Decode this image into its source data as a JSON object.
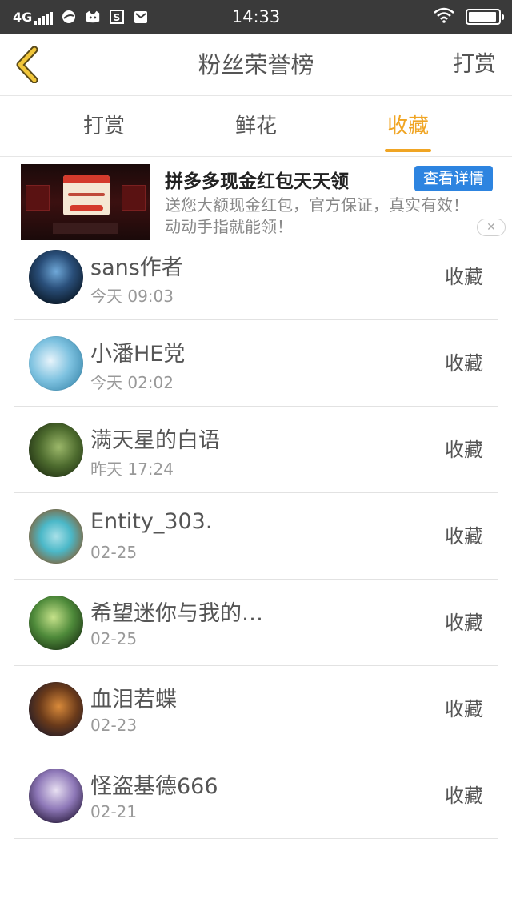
{
  "status_bar": {
    "network": "4G",
    "time": "14:33",
    "icons": [
      "signal-icon",
      "weather-icon",
      "cat-icon",
      "s-icon",
      "mail-icon",
      "wifi-icon",
      "battery-icon"
    ],
    "battery_level": 0.95
  },
  "nav": {
    "title": "粉丝荣誉榜",
    "right_action": "打赏",
    "back_icon": "back-chevron-icon"
  },
  "tabs": [
    {
      "label": "打赏",
      "active": false
    },
    {
      "label": "鲜花",
      "active": false
    },
    {
      "label": "收藏",
      "active": true
    }
  ],
  "colors": {
    "accent": "#f0a524",
    "ad_button": "#2d84e0",
    "status_bar": "#3a3a3a"
  },
  "ad": {
    "title": "拼多多现金红包天天领",
    "cta": "查看详情",
    "desc": "送您大额现金红包，官方保证，真实有效！动动手指就能领！",
    "close": "✕"
  },
  "list": [
    {
      "name": "sans作者",
      "time": "今天 09:03",
      "action": "收藏"
    },
    {
      "name": "小潘HE党",
      "time": "今天 02:02",
      "action": "收藏"
    },
    {
      "name": "满天星的白语",
      "time": "昨天 17:24",
      "action": "收藏"
    },
    {
      "name": "Entity_303.",
      "time": "02-25",
      "action": "收藏"
    },
    {
      "name": "希望迷你与我的…",
      "time": "02-25",
      "action": "收藏"
    },
    {
      "name": "血泪若蝶",
      "time": "02-23",
      "action": "收藏"
    },
    {
      "name": "怪盗基德666",
      "time": "02-21",
      "action": "收藏"
    }
  ]
}
